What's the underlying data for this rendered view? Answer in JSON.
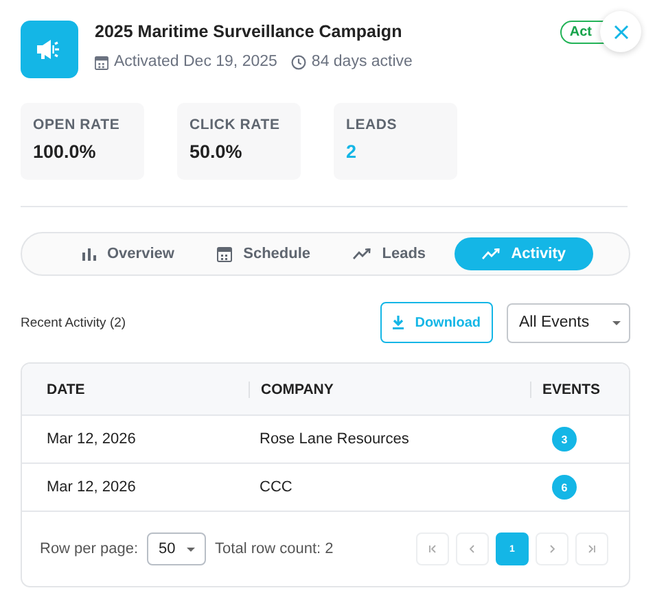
{
  "campaign": {
    "title": "2025 Maritime Surveillance Campaign",
    "activated": "Activated Dec 19, 2025",
    "duration": "84 days active",
    "status": "Act"
  },
  "stats": [
    {
      "label": "OPEN RATE",
      "value": "100.0%",
      "highlight": false
    },
    {
      "label": "CLICK RATE",
      "value": "50.0%",
      "highlight": false
    },
    {
      "label": "LEADS",
      "value": "2",
      "highlight": true
    }
  ],
  "tabs": [
    {
      "label": "Overview",
      "kind": "bars",
      "selected": false
    },
    {
      "label": "Schedule",
      "kind": "calendar",
      "selected": false
    },
    {
      "label": "Leads",
      "kind": "trend",
      "selected": false
    },
    {
      "label": "Activity",
      "kind": "trend",
      "selected": true
    }
  ],
  "activity": {
    "title": "Recent Activity (2)",
    "download": "Download",
    "filter": "All Events"
  },
  "table": {
    "columns": [
      "DATE",
      "COMPANY",
      "EVENTS"
    ],
    "rows": [
      {
        "date": "Mar 12, 2026",
        "company": "Rose Lane Resources",
        "events": "3"
      },
      {
        "date": "Mar 12, 2026",
        "company": "CCC",
        "events": "6"
      }
    ]
  },
  "pagination": {
    "rows_label": "Row per page:",
    "page_size": "50",
    "total": "Total row count: 2",
    "pages": [
      {
        "label": "1",
        "selected": true
      }
    ]
  }
}
